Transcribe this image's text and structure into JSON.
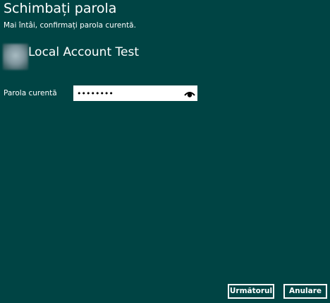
{
  "page": {
    "title": "Schimbați parola",
    "subtitle": "Mai întâi, confirmați parola curentă."
  },
  "account": {
    "name": "Local Account Test"
  },
  "password_field": {
    "label": "Parola curentă",
    "value": "••••••••",
    "reveal_icon": "eye-icon"
  },
  "buttons": {
    "next_label": "Următorul",
    "cancel_label": "Anulare"
  },
  "colors": {
    "background": "#004444",
    "text": "#ffffff",
    "field_background": "#ffffff"
  }
}
